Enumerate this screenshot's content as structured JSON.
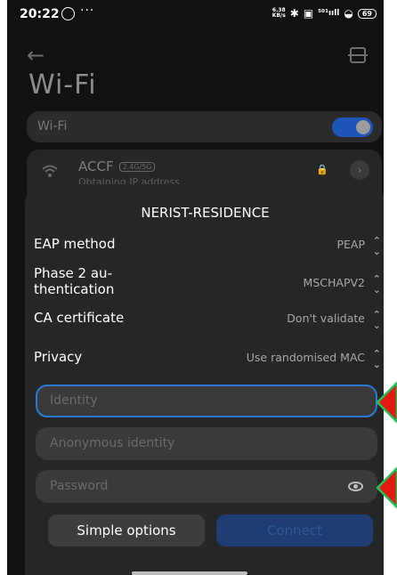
{
  "status_bar": {
    "time": "20:22",
    "dots": "···",
    "speed_top": "6.38",
    "speed_bottom": "KB/s",
    "bluetooth_glyph": "✱",
    "sim_glyph": "▣",
    "signal_glyph": "⁵⁰¹ııll",
    "wifi_glyph": "◒",
    "battery": "69"
  },
  "header": {
    "back_glyph": "←",
    "title": "Wi-Fi"
  },
  "wifi_toggle": {
    "label": "Wi-Fi",
    "state": "on"
  },
  "network": {
    "name": "ACCF",
    "badge": "2.4G/5G",
    "status": "Obtaining IP address...",
    "lock_glyph": "🔒",
    "detail_glyph": "›"
  },
  "dialog": {
    "title": "NERIST-RESIDENCE",
    "settings": [
      {
        "label": "EAP method",
        "value": "PEAP"
      },
      {
        "label": "Phase 2 au-\nthentication",
        "value": "MSCHAPV2"
      },
      {
        "label": "CA certificate",
        "value": "Don't validate"
      },
      {
        "label": "Privacy",
        "value": "Use randomised MAC"
      }
    ],
    "chevron_glyph": "⌃\n⌄",
    "identity_placeholder": "Identity",
    "anonymous_placeholder": "Anonymous identity",
    "password_placeholder": "Password",
    "simple_options_label": "Simple options",
    "connect_label": "Connect"
  },
  "colors": {
    "accent": "#2a78d6",
    "toggle_on": "#1f55b8",
    "annotation_fill": "#e41b13",
    "annotation_stroke": "#22c55e"
  }
}
